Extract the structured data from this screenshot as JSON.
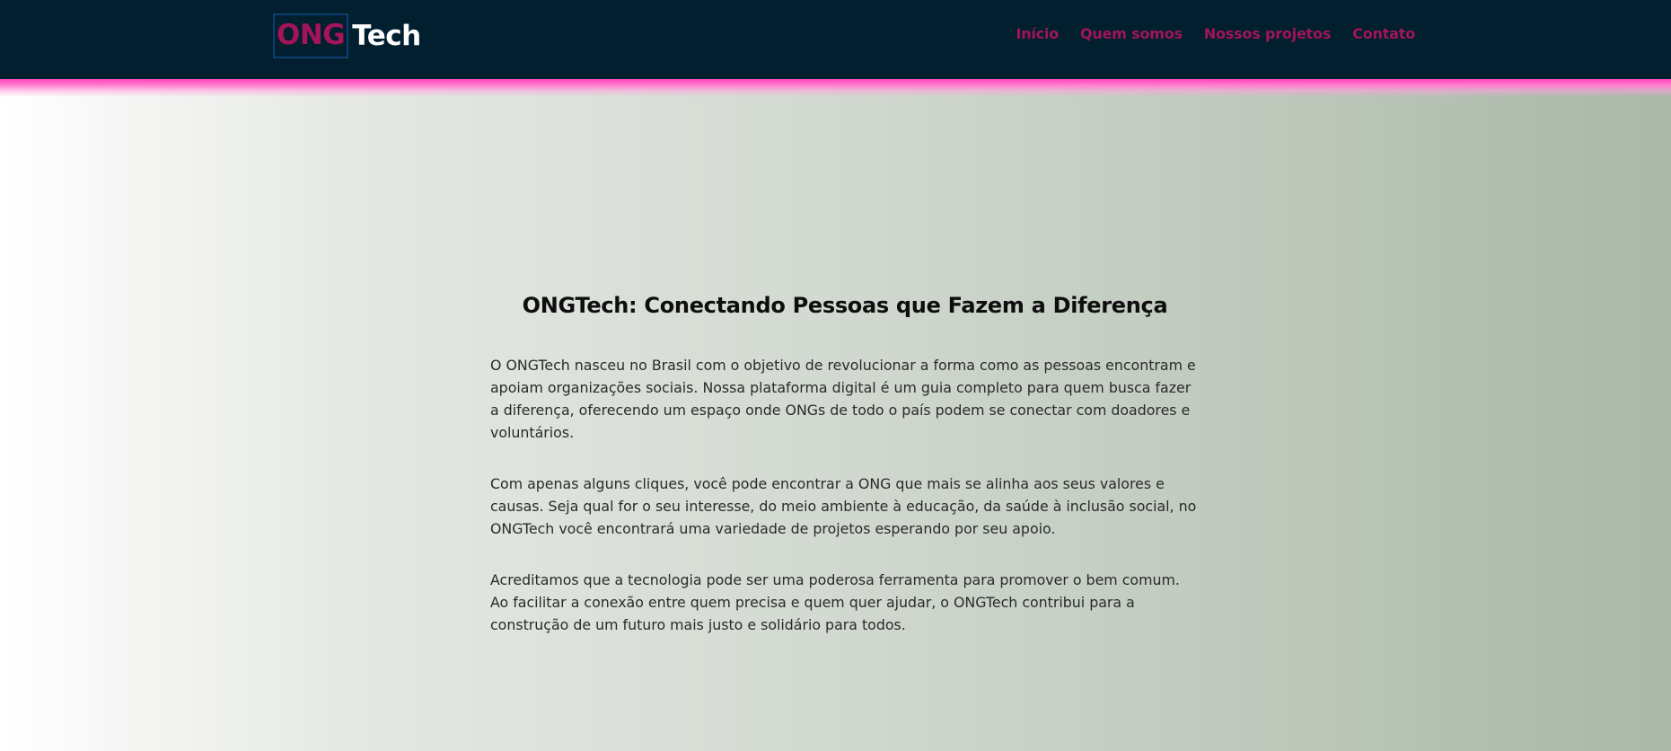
{
  "header": {
    "logo_part1": "ONG",
    "logo_part2": "Tech",
    "nav": [
      {
        "label": "Início"
      },
      {
        "label": "Quem somos"
      },
      {
        "label": "Nossos projetos"
      },
      {
        "label": "Contato"
      }
    ]
  },
  "main": {
    "title": "ONGTech: Conectando Pessoas que Fazem a Diferença",
    "paragraphs": [
      "O ONGTech nasceu no Brasil com o objetivo de revolucionar a forma como as pessoas encontram e apoiam organizações sociais. Nossa plataforma digital é um guia completo para quem busca fazer a diferença, oferecendo um espaço onde ONGs de todo o país podem se conectar com doadores e voluntários.",
      "Com apenas alguns cliques, você pode encontrar a ONG que mais se alinha aos seus valores e causas. Seja qual for o seu interesse, do meio ambiente à educação, da saúde à inclusão social, no ONGTech você encontrará uma variedade de projetos esperando por seu apoio.",
      "Acreditamos que a tecnologia pode ser uma poderosa ferramenta para promover o bem comum. Ao facilitar a conexão entre quem precisa e quem quer ajudar, o ONGTech contribui para a construção de um futuro mais justo e solidário para todos."
    ]
  },
  "colors": {
    "header_bg": "#011f2f",
    "accent_pink": "#a3145a",
    "accent_line": "#ff45b9",
    "logo_border": "#0d3f73",
    "gradient_left": "#ffffff",
    "gradient_right": "#a9b8a7"
  }
}
